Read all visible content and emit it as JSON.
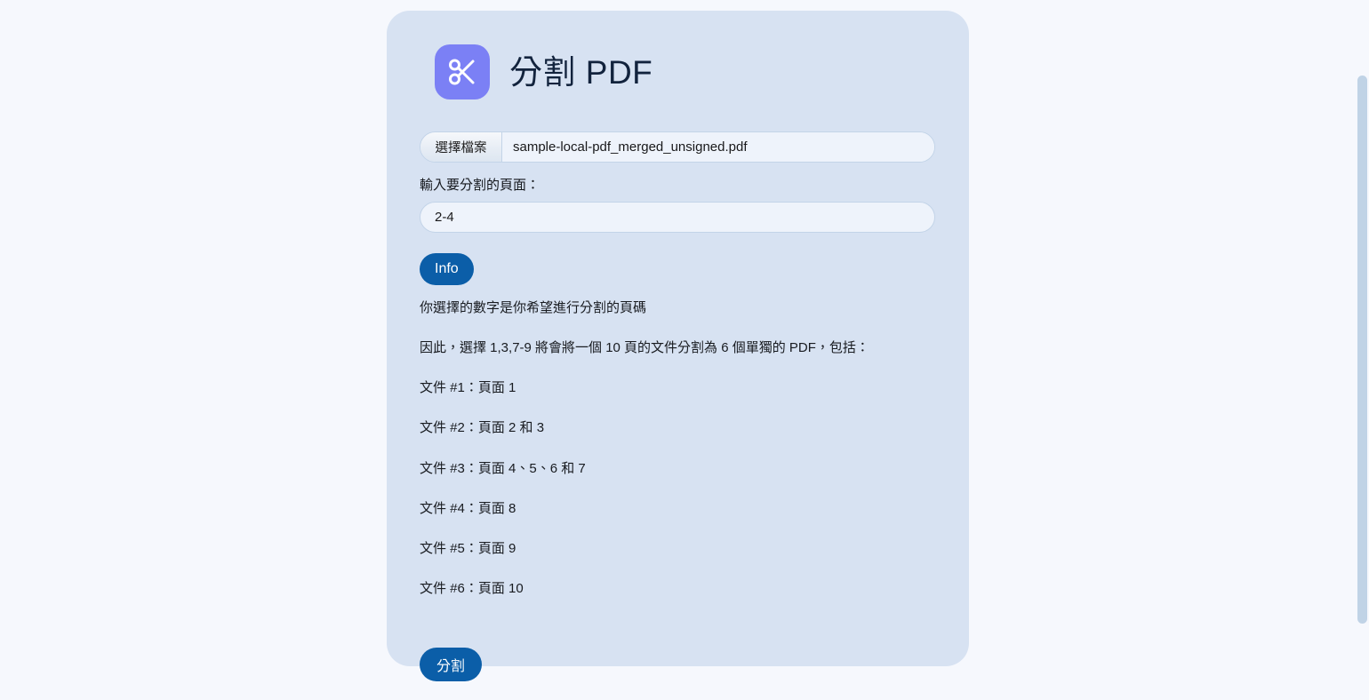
{
  "app": {
    "title": "分割 PDF",
    "icon": "scissors-icon",
    "icon_bg": "#7b80f5",
    "card_bg": "#d7e2f2",
    "page_bg": "#f6f8fd",
    "accent": "#0b5ea8"
  },
  "file_input": {
    "button_label": "選擇檔案",
    "file_name": "sample-local-pdf_merged_unsigned.pdf"
  },
  "pages_field": {
    "label": "輸入要分割的頁面：",
    "value": "2-4",
    "placeholder": ""
  },
  "info": {
    "badge_label": "Info",
    "lines": [
      "你選擇的數字是你希望進行分割的頁碼",
      "因此，選擇 1,3,7-9 將會將一個 10 頁的文件分割為 6 個單獨的 PDF，包括："
    ],
    "documents": [
      "文件 #1：頁面 1",
      "文件 #2：頁面 2 和 3",
      "文件 #3：頁面 4、5、6 和 7",
      "文件 #4：頁面 8",
      "文件 #5：頁面 9",
      "文件 #6：頁面 10"
    ]
  },
  "submit": {
    "label": "分割"
  },
  "scrollbar": {
    "thumb_color": "#c0d3e6"
  }
}
